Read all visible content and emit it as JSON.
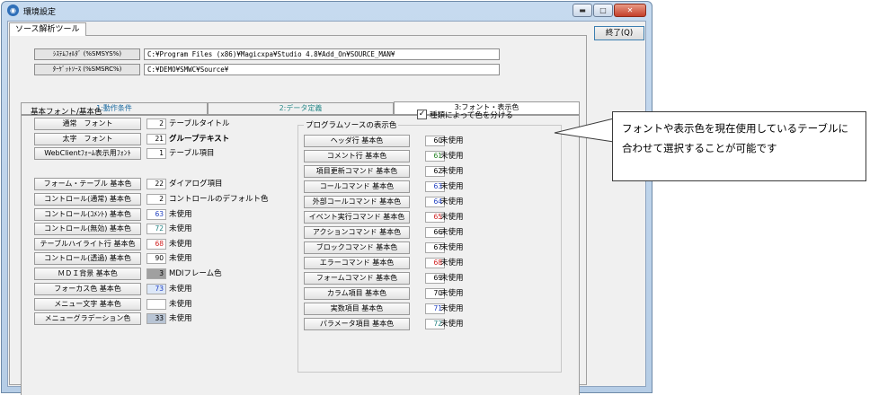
{
  "window": {
    "title": "環境設定",
    "icon": "settings-app-icon",
    "caption_buttons": {
      "minimize": "▬",
      "maximize": "□",
      "close": "✕"
    }
  },
  "outer_tab": "ソース解析ツール",
  "end_button": "終了(Q)",
  "paths": {
    "system_folder": {
      "label": "ｼｽﾃﾑﾌｫﾙﾀﾞ (%SMSYS%)",
      "value": "C:¥Program Files (x86)¥Magicxpa¥Studio 4.8¥Add_On¥SOURCE_MAN¥"
    },
    "target_source": {
      "label": "ﾀｰｹﾞｯﾄｿｰｽ (%SMSRC%)",
      "value": "C:¥DEMO¥SMWC¥Source¥"
    }
  },
  "tabs": [
    "1:動作条件",
    "2:データ定義",
    "3:フォント・表示色"
  ],
  "left_section": {
    "title": "基本フォント/基本色",
    "fonts": [
      {
        "button": "通常　フォント",
        "value": "2",
        "label": "テーブルタイトル"
      },
      {
        "button": "太字　フォント",
        "value": "21",
        "label": "グループテキスト"
      },
      {
        "button": "WebClientﾌｫｰﾑ表示用ﾌｫﾝﾄ",
        "value": "1",
        "label": "テーブル項目"
      }
    ],
    "colors": [
      {
        "button": "フォーム・テーブル 基本色",
        "value": "22",
        "label": "ダイアログ項目",
        "text_color": "#000000",
        "bg": "#ffffff"
      },
      {
        "button": "コントロール(通常) 基本色",
        "value": "2",
        "label": "コントロールのデフォルト色",
        "text_color": "#000000",
        "bg": "#ffffff"
      },
      {
        "button": "コントロール(ｺﾒﾝﾄ) 基本色",
        "value": "63",
        "label": "未使用",
        "text_color": "#2040c0",
        "bg": "#ffffff"
      },
      {
        "button": "コントロール(無効) 基本色",
        "value": "72",
        "label": "未使用",
        "text_color": "#208080",
        "bg": "#ffffff"
      },
      {
        "button": "テーブルハイライト行 基本色",
        "value": "68",
        "label": "未使用",
        "text_color": "#d02020",
        "bg": "#ffffff"
      },
      {
        "button": "コントロール(透過) 基本色",
        "value": "90",
        "label": "未使用",
        "text_color": "#000000",
        "bg": "#ffffff"
      },
      {
        "button": "ＭＤＩ背景 基本色",
        "value": "3",
        "label": "MDIフレーム色",
        "text_color": "#000000",
        "bg": "#a0a0a0"
      },
      {
        "button": "フォーカス色 基本色",
        "value": "73",
        "label": "未使用",
        "text_color": "#2040c0",
        "bg": "#dde8f8"
      },
      {
        "button": "メニュー文字 基本色",
        "value": "",
        "label": "未使用",
        "text_color": "#000000",
        "bg": "#ffffff"
      },
      {
        "button": "メニューグラデーション色",
        "value": "33",
        "label": "未使用",
        "text_color": "#000000",
        "bg": "#b8c4d4"
      }
    ]
  },
  "right_section": {
    "checkbox_label": "種類によって色を分ける",
    "checkbox_checked": true,
    "title": "プログラムソースの表示色",
    "colors": [
      {
        "button": "ヘッダ行 基本色",
        "value": "60",
        "label": "未使用",
        "text_color": "#000000"
      },
      {
        "button": "コメント行 基本色",
        "value": "61",
        "label": "未使用",
        "text_color": "#208020"
      },
      {
        "button": "項目更新コマンド 基本色",
        "value": "62",
        "label": "未使用",
        "text_color": "#000000"
      },
      {
        "button": "コールコマンド 基本色",
        "value": "63",
        "label": "未使用",
        "text_color": "#2040c0"
      },
      {
        "button": "外部コールコマンド 基本色",
        "value": "64",
        "label": "未使用",
        "text_color": "#2040c0"
      },
      {
        "button": "イベント実行コマンド 基本色",
        "value": "65",
        "label": "未使用",
        "text_color": "#d02020"
      },
      {
        "button": "アクションコマンド 基本色",
        "value": "66",
        "label": "未使用",
        "text_color": "#000000"
      },
      {
        "button": "ブロックコマンド 基本色",
        "value": "67",
        "label": "未使用",
        "text_color": "#000000"
      },
      {
        "button": "エラーコマンド 基本色",
        "value": "68",
        "label": "未使用",
        "text_color": "#d02020"
      },
      {
        "button": "フォームコマンド 基本色",
        "value": "69",
        "label": "未使用",
        "text_color": "#000000"
      },
      {
        "button": "カラム項目 基本色",
        "value": "70",
        "label": "未使用",
        "text_color": "#000000"
      },
      {
        "button": "実数項目 基本色",
        "value": "71",
        "label": "未使用",
        "text_color": "#2040c0"
      },
      {
        "button": "パラメータ項目 基本色",
        "value": "72",
        "label": "未使用",
        "text_color": "#208080"
      }
    ]
  },
  "callout": {
    "text": "フォントや表示色を現在使用しているテーブルに合わせて選択することが可能です"
  }
}
